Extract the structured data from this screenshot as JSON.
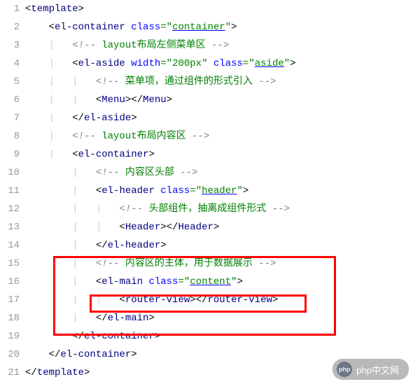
{
  "watermark": {
    "logo": "php",
    "text": "php中文网"
  },
  "gutter": [
    "1",
    "2",
    "3",
    "4",
    "5",
    "6",
    "7",
    "8",
    "9",
    "10",
    "11",
    "12",
    "13",
    "14",
    "15",
    "16",
    "17",
    "18",
    "19",
    "20",
    "21"
  ],
  "tags": {
    "template_open": "template",
    "template_close": "template",
    "el_container": "el-container",
    "el_aside": "el-aside",
    "menu": "Menu",
    "el_header": "el-header",
    "header": "Header",
    "el_main": "el-main",
    "router_view": "router-view"
  },
  "attrs": {
    "class": "class",
    "width": "width"
  },
  "values": {
    "container": "container",
    "width200": "200px",
    "aside": "aside",
    "header": "header",
    "content": "content"
  },
  "comments": {
    "c1": " layout布局左侧菜单区 ",
    "c2": " 菜单项，通过组件的形式引入 ",
    "c3": " layout布局内容区 ",
    "c4": " 内容区头部 ",
    "c5": " 头部组件，抽离成组件形式 ",
    "c6": " 内容区的主体，用于数据展示 "
  },
  "punct": {
    "lt": "<",
    "gt": ">",
    "lts": "</",
    "eq": "=",
    "q": "\"",
    "cstart": "<!--",
    "cend": "-->"
  },
  "guides": {
    "l2": "    ",
    "l3": "    |   ",
    "l4": "    |   ",
    "l5": "    |   |   ",
    "l6": "    |   |   ",
    "l7": "    |   ",
    "l8": "    |   ",
    "l9": "    |   ",
    "l10": "        |   ",
    "l11": "        |   ",
    "l12": "        |   |   ",
    "l13": "        |   |   ",
    "l14": "        |   ",
    "l15": "        |   ",
    "l16": "        |   ",
    "l17": "        |   |   ",
    "l18": "        |   ",
    "l19": "        ",
    "l20": "    "
  }
}
